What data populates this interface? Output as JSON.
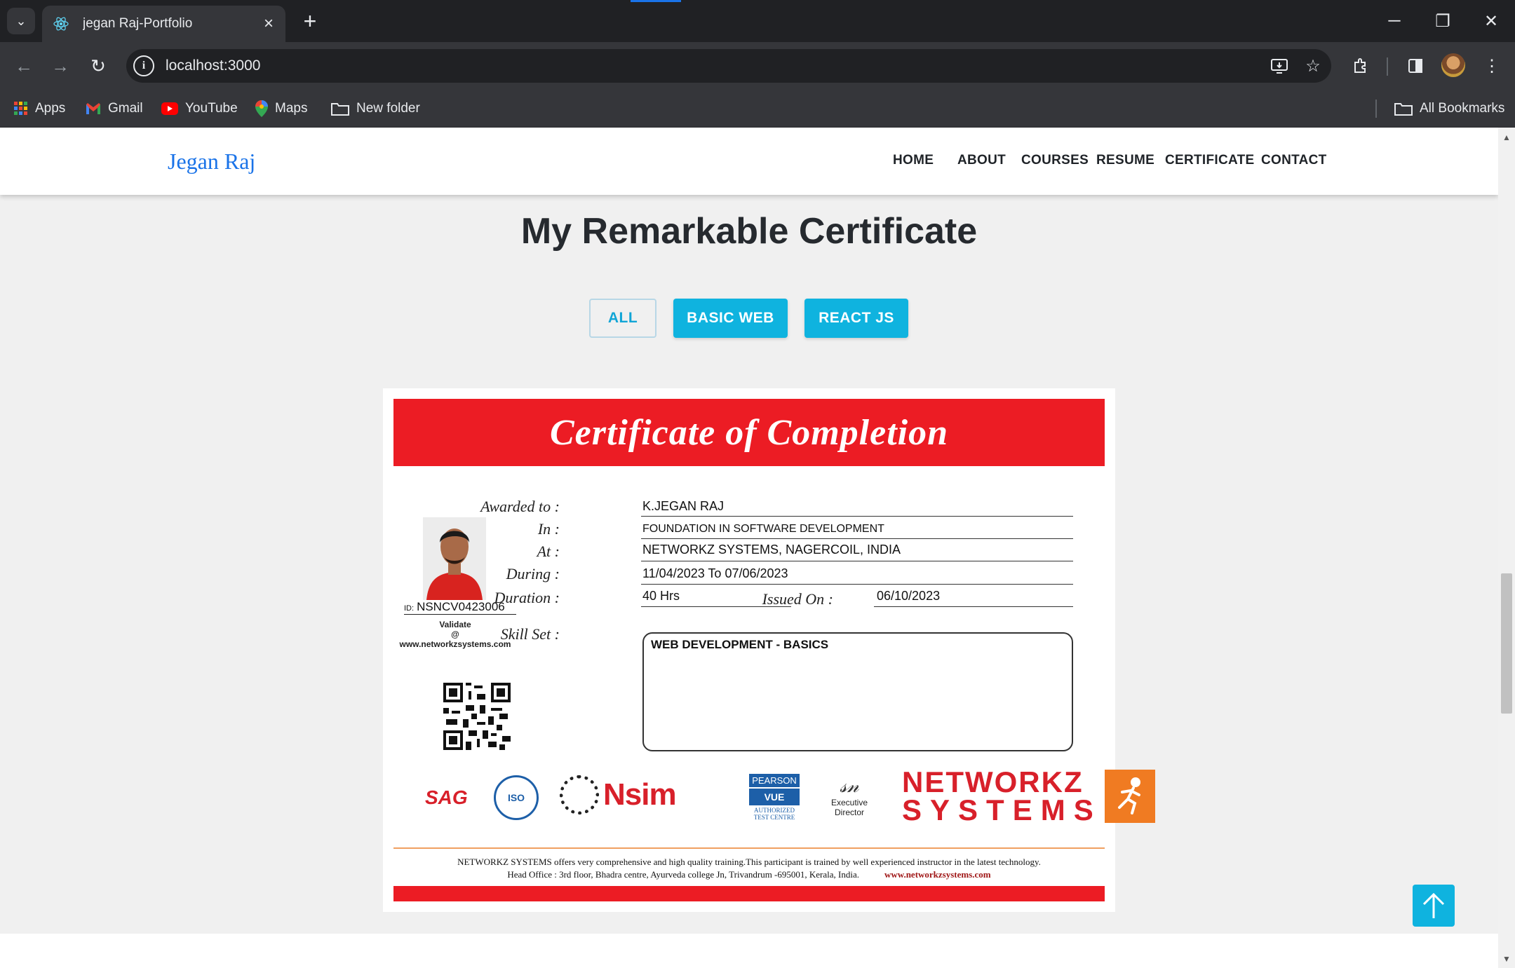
{
  "browser": {
    "tab_title": "jegan Raj-Portfolio",
    "url": "localhost:3000",
    "bookmarks": [
      {
        "label": "Apps"
      },
      {
        "label": "Gmail"
      },
      {
        "label": "YouTube"
      },
      {
        "label": "Maps"
      },
      {
        "label": "New folder"
      }
    ],
    "all_bookmarks": "All Bookmarks"
  },
  "site": {
    "brand": "Jegan Raj",
    "nav": [
      "HOME",
      "ABOUT",
      "COURSES",
      "RESUME",
      "CERTIFICATE",
      "CONTACT"
    ]
  },
  "section": {
    "title": "My Remarkable Certificate",
    "filters": [
      "ALL",
      "BASIC WEB",
      "REACT JS"
    ],
    "active_filter": "ALL"
  },
  "certificate": {
    "heading": "Certificate of Completion",
    "id_prefix": "ID:",
    "id": "NSNCV0423006",
    "validate": [
      "Validate",
      "@",
      "www.networkzsystems.com"
    ],
    "fields": {
      "awarded_to_label": "Awarded to :",
      "awarded_to": "K.JEGAN RAJ",
      "in_label": "In :",
      "in": "FOUNDATION IN SOFTWARE DEVELOPMENT",
      "at_label": "At :",
      "at": "NETWORKZ SYSTEMS,  NAGERCOIL, INDIA",
      "during_label": "During :",
      "during": "11/04/2023 To 07/06/2023",
      "duration_label": "Duration :",
      "duration": "40 Hrs",
      "issued_label": "Issued On :",
      "issued": "06/10/2023",
      "skill_label": "Skill Set :",
      "skill": "WEB DEVELOPMENT - BASICS"
    },
    "logos": {
      "sag": "SAG",
      "iso": "ISO",
      "nsim": "Nsim",
      "pearson_top": "PEARSON",
      "pearson_vue": "VUE",
      "pearson_sub": "AUTHORIZED TEST CENTRE",
      "exec_label": "Executive Director",
      "nz_line1": "NETWORKZ",
      "nz_line2": "SYSTEMS"
    },
    "footer_line1": "NETWORKZ SYSTEMS offers very comprehensive and high quality training.This participant is trained by well experienced instructor in the latest technology.",
    "footer_line2": "Head Office : 3rd floor, Bhadra centre, Ayurveda college Jn, Trivandrum -695001, Kerala, India.",
    "footer_site": "www.networkzsystems.com"
  },
  "colors": {
    "accent": "#0fb3df",
    "brand": "#1a73e8",
    "cert_red": "#ec1c24"
  }
}
